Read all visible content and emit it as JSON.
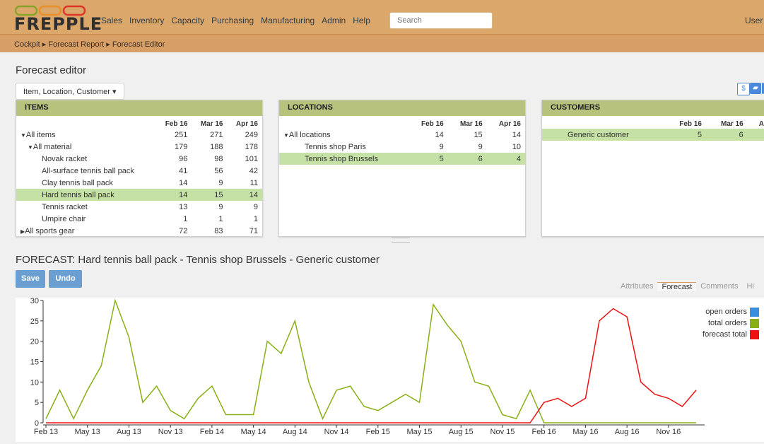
{
  "app": {
    "logo": "FREPPLE"
  },
  "menu": [
    "Sales",
    "Inventory",
    "Capacity",
    "Purchasing",
    "Manufacturing",
    "Admin",
    "Help"
  ],
  "search": {
    "placeholder": "Search"
  },
  "user": "User A",
  "breadcrumb": [
    "Cockpit",
    "Forecast Report",
    "Forecast Editor"
  ],
  "page_title": "Forecast editor",
  "hierarchy_select": "Item, Location, Customer",
  "toolbar_icons": [
    "dollar-icon",
    "truck-icon"
  ],
  "months": [
    "Feb 16",
    "Mar 16",
    "Apr 16"
  ],
  "items_panel": {
    "title": "ITEMS",
    "rows": [
      {
        "label": "All items",
        "toggle": "▼",
        "indent": 0,
        "values": [
          "251",
          "271",
          "249"
        ]
      },
      {
        "label": "All material",
        "toggle": "▼",
        "indent": 1,
        "values": [
          "179",
          "188",
          "178"
        ]
      },
      {
        "label": "Novak racket",
        "toggle": "",
        "indent": 2,
        "values": [
          "96",
          "98",
          "101"
        ]
      },
      {
        "label": "All-surface tennis ball pack",
        "toggle": "",
        "indent": 2,
        "values": [
          "41",
          "56",
          "42"
        ]
      },
      {
        "label": "Clay tennis ball pack",
        "toggle": "",
        "indent": 2,
        "values": [
          "14",
          "9",
          "11"
        ]
      },
      {
        "label": "Hard tennis ball pack",
        "toggle": "",
        "indent": 2,
        "values": [
          "14",
          "15",
          "14"
        ],
        "selected": true
      },
      {
        "label": "Tennis racket",
        "toggle": "",
        "indent": 2,
        "values": [
          "13",
          "9",
          "9"
        ]
      },
      {
        "label": "Umpire chair",
        "toggle": "",
        "indent": 2,
        "values": [
          "1",
          "1",
          "1"
        ]
      },
      {
        "label": "All sports gear",
        "toggle": "▶",
        "indent": 0,
        "values": [
          "72",
          "83",
          "71"
        ]
      }
    ]
  },
  "locations_panel": {
    "title": "LOCATIONS",
    "rows": [
      {
        "label": "All locations",
        "toggle": "▼",
        "indent": 0,
        "values": [
          "14",
          "15",
          "14"
        ]
      },
      {
        "label": "Tennis shop Paris",
        "toggle": "",
        "indent": 2,
        "values": [
          "9",
          "9",
          "10"
        ]
      },
      {
        "label": "Tennis shop Brussels",
        "toggle": "",
        "indent": 2,
        "values": [
          "5",
          "6",
          "4"
        ],
        "selected": true
      }
    ]
  },
  "customers_panel": {
    "title": "CUSTOMERS",
    "months": [
      "Feb 16",
      "Mar 16",
      "Apr"
    ],
    "rows": [
      {
        "label": "Generic customer",
        "toggle": "",
        "indent": 2,
        "values": [
          "5",
          "6",
          ""
        ],
        "selected": true
      }
    ]
  },
  "forecast": {
    "title": "FORECAST: Hard tennis ball pack  -  Tennis shop Brussels  -  Generic customer",
    "save": "Save",
    "undo": "Undo",
    "tabs": [
      "Attributes",
      "Forecast",
      "Comments",
      "Hi"
    ],
    "active_tab": "Forecast"
  },
  "chart_data": {
    "type": "line",
    "x_ticks": [
      "Feb 13",
      "May 13",
      "Aug 13",
      "Nov 13",
      "Feb 14",
      "May 14",
      "Aug 14",
      "Nov 14",
      "Feb 15",
      "May 15",
      "Aug 15",
      "Nov 15",
      "Feb 16",
      "May 16",
      "Aug 16",
      "Nov 16"
    ],
    "y_ticks": [
      "0",
      "5",
      "10",
      "15",
      "20",
      "25",
      "30"
    ],
    "ylim": [
      0,
      30
    ],
    "series": [
      {
        "name": "open orders",
        "color": "#3b8ede",
        "x_start": 0,
        "values": []
      },
      {
        "name": "total orders",
        "color": "#88b016",
        "x_start": 0,
        "values": [
          1,
          8,
          1,
          8,
          14,
          30,
          21,
          5,
          9,
          3,
          1,
          6,
          9,
          2,
          2,
          2,
          20,
          17,
          25,
          10,
          1,
          8,
          9,
          4,
          3,
          5,
          7,
          5,
          29,
          24,
          20,
          10,
          9,
          2,
          1,
          8,
          0,
          0,
          0,
          0,
          0,
          0,
          0,
          0,
          0,
          0,
          0,
          0
        ]
      },
      {
        "name": "forecast total",
        "color": "#ee1111",
        "x_start": 0,
        "values": [
          0,
          0,
          0,
          0,
          0,
          0,
          0,
          0,
          0,
          0,
          0,
          0,
          0,
          0,
          0,
          0,
          0,
          0,
          0,
          0,
          0,
          0,
          0,
          0,
          0,
          0,
          0,
          0,
          0,
          0,
          0,
          0,
          0,
          0,
          0,
          0,
          5,
          6,
          4,
          6,
          25,
          28,
          26,
          10,
          7,
          6,
          4,
          8
        ]
      }
    ]
  }
}
